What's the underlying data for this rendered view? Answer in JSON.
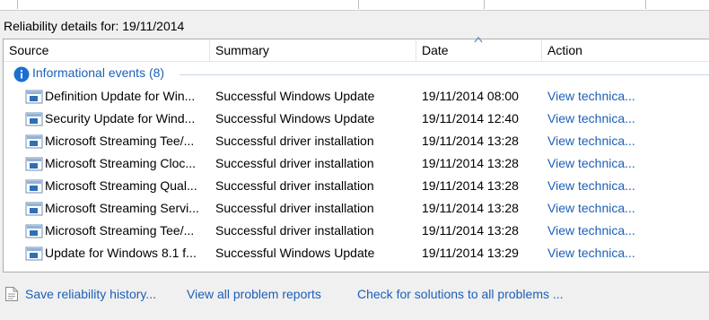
{
  "details_title": "Reliability details for: 19/11/2014",
  "columns": {
    "source": "Source",
    "summary": "Summary",
    "date": "Date",
    "action": "Action"
  },
  "group": {
    "label": "Informational events (8)",
    "icon": "info-icon"
  },
  "rows": [
    {
      "source": "Definition Update for Win...",
      "summary": "Successful Windows Update",
      "date": "19/11/2014 08:00",
      "action": "View technica..."
    },
    {
      "source": "Security Update for Wind...",
      "summary": "Successful Windows Update",
      "date": "19/11/2014 12:40",
      "action": "View technica..."
    },
    {
      "source": "Microsoft Streaming Tee/...",
      "summary": "Successful driver installation",
      "date": "19/11/2014 13:28",
      "action": "View technica..."
    },
    {
      "source": "Microsoft Streaming Cloc...",
      "summary": "Successful driver installation",
      "date": "19/11/2014 13:28",
      "action": "View technica..."
    },
    {
      "source": "Microsoft Streaming Qual...",
      "summary": "Successful driver installation",
      "date": "19/11/2014 13:28",
      "action": "View technica..."
    },
    {
      "source": "Microsoft Streaming Servi...",
      "summary": "Successful driver installation",
      "date": "19/11/2014 13:28",
      "action": "View technica..."
    },
    {
      "source": "Microsoft Streaming Tee/...",
      "summary": "Successful driver installation",
      "date": "19/11/2014 13:28",
      "action": "View technica..."
    },
    {
      "source": "Update for Windows 8.1 f...",
      "summary": "Successful Windows Update",
      "date": "19/11/2014 13:29",
      "action": "View technica..."
    }
  ],
  "bottom_links": {
    "save": "Save reliability history...",
    "view_all": "View all problem reports",
    "check": "Check for solutions to all problems ..."
  },
  "colors": {
    "link": "#1c5fb8",
    "background": "#f0f0f0",
    "panel": "#ffffff"
  }
}
